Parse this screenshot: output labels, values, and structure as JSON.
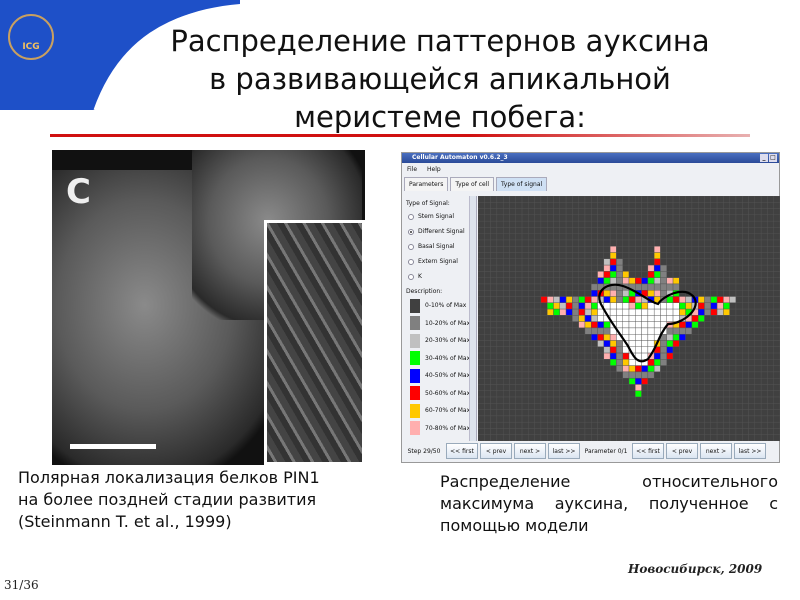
{
  "slide": {
    "title_lines": [
      "Распределение паттернов ауксина",
      "в развивающейся апикальной",
      "меристеме побега:"
    ],
    "logo_text": "ICG",
    "figure_letter": "C",
    "caption_left": [
      "Полярная локализация белков PIN1",
      "на более поздней стадии развития",
      "(Steinmann T. et al., 1999)"
    ],
    "caption_right": "Распределение относительного максимума ауксина, полученное с помощью модели",
    "footer": "Новосибирск, 2009",
    "page": "31/36"
  },
  "app": {
    "title": "Cellular Automaton v0.6.2_3",
    "menu": [
      "File",
      "Help"
    ],
    "tabs": [
      "Parameters",
      "Type of cell",
      "Type of signal"
    ],
    "active_tab": "Type of signal",
    "signal_header": "Type of Signal:",
    "signals": [
      {
        "label": "Stem Signal",
        "selected": false
      },
      {
        "label": "Different Signal",
        "selected": true
      },
      {
        "label": "Basal Signal",
        "selected": false
      },
      {
        "label": "Extern Signal",
        "selected": false
      },
      {
        "label": "K",
        "selected": false
      }
    ],
    "description_header": "Description:",
    "legend": [
      {
        "label": "0-10%  of Max",
        "color": "#404040"
      },
      {
        "label": "10-20%  of Max",
        "color": "#808080"
      },
      {
        "label": "20-30%  of Max",
        "color": "#c0c0c0"
      },
      {
        "label": "30-40%  of Max",
        "color": "#00ff00"
      },
      {
        "label": "40-50%  of Max",
        "color": "#0000ff"
      },
      {
        "label": "50-60%  of Max",
        "color": "#ff0000"
      },
      {
        "label": "60-70%  of Max",
        "color": "#ffc800"
      },
      {
        "label": "70-80%  of Max",
        "color": "#ffafaf"
      }
    ],
    "step_label": "Step 29/50",
    "param_label": "Parameter 0/1",
    "nav_buttons": [
      "<< first",
      "< prev",
      "next >",
      "last >>"
    ]
  }
}
